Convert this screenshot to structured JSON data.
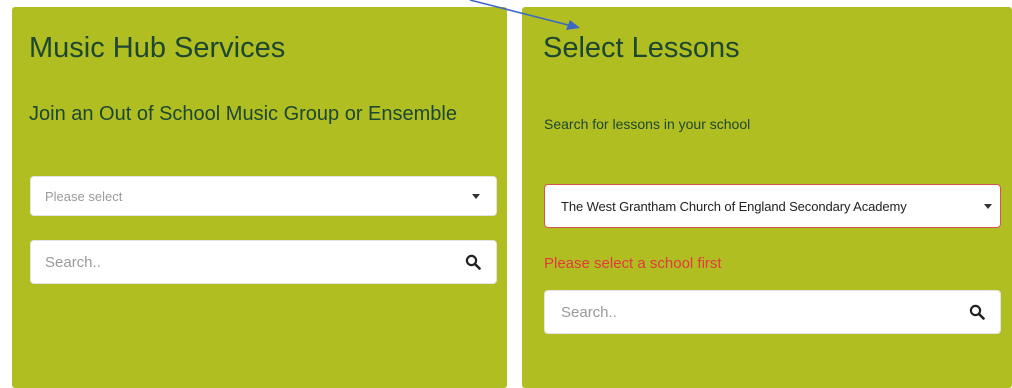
{
  "music_hub": {
    "title": "Music Hub Services",
    "subtitle": "Join an Out of School Music Group or Ensemble",
    "select": {
      "value": "Please select"
    },
    "search": {
      "placeholder": "Search.."
    }
  },
  "lessons": {
    "title": "Select Lessons",
    "hint": "Search for lessons in your school",
    "school_select": {
      "value": "The West Grantham Church of England Secondary Academy"
    },
    "error": "Please select a school first",
    "search": {
      "placeholder": "Search.."
    }
  },
  "colors": {
    "panel_bg": "#b0be22",
    "heading": "#1d4731",
    "error": "#e23b3b",
    "select_error_border": "#d9534f",
    "annotation_arrow": "#3c67c4"
  },
  "icons": {
    "search": "search-icon",
    "dropdown": "caret-down-icon",
    "annotation": "arrow-icon"
  }
}
